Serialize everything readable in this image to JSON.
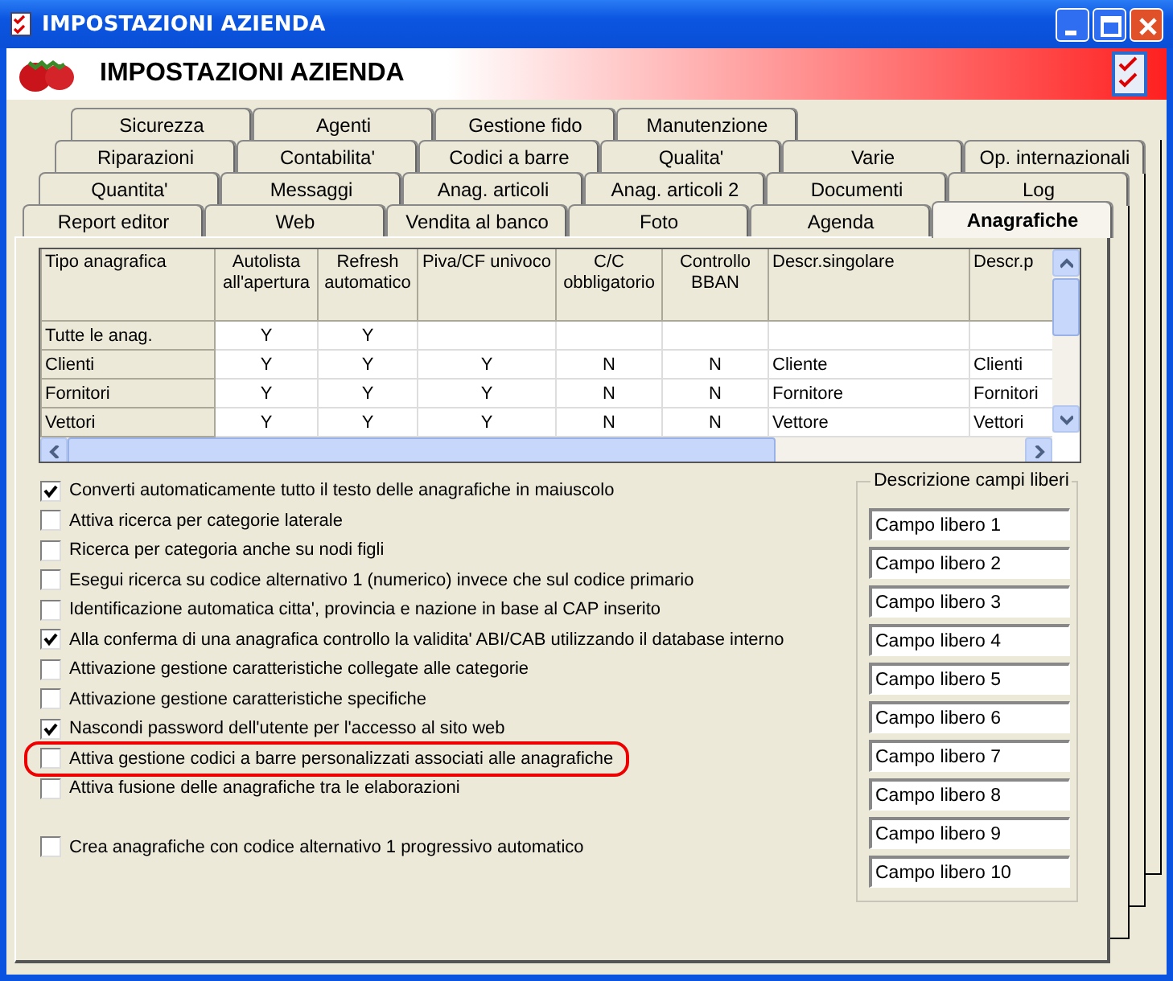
{
  "window": {
    "title": "IMPOSTAZIONI AZIENDA"
  },
  "header": {
    "title": "IMPOSTAZIONI AZIENDA"
  },
  "tab_rows": [
    [
      {
        "label": "Sicurezza",
        "selected": false
      },
      {
        "label": "Agenti",
        "selected": false
      },
      {
        "label": "Gestione fido",
        "selected": false
      },
      {
        "label": "Manutenzione",
        "selected": false
      }
    ],
    [
      {
        "label": "Riparazioni",
        "selected": false
      },
      {
        "label": "Contabilita'",
        "selected": false
      },
      {
        "label": "Codici a barre",
        "selected": false
      },
      {
        "label": "Qualita'",
        "selected": false
      },
      {
        "label": "Varie",
        "selected": false
      },
      {
        "label": "Op. internazionali",
        "selected": false
      }
    ],
    [
      {
        "label": "Quantita'",
        "selected": false
      },
      {
        "label": "Messaggi",
        "selected": false
      },
      {
        "label": "Anag. articoli",
        "selected": false
      },
      {
        "label": "Anag. articoli 2",
        "selected": false
      },
      {
        "label": "Documenti",
        "selected": false
      },
      {
        "label": "Log",
        "selected": false
      }
    ],
    [
      {
        "label": "Report editor",
        "selected": false
      },
      {
        "label": "Web",
        "selected": false
      },
      {
        "label": "Vendita al banco",
        "selected": false
      },
      {
        "label": "Foto",
        "selected": false
      },
      {
        "label": "Agenda",
        "selected": false
      },
      {
        "label": "Anagrafiche",
        "selected": true
      }
    ]
  ],
  "table": {
    "columns": [
      "Tipo anagrafica",
      "Autolista all'apertura",
      "Refresh automatico",
      "Piva/CF univoco",
      "C/C obbligatorio",
      "Controllo BBAN",
      "Descr.singolare",
      "Descr.p"
    ],
    "rows": [
      [
        "Tutte le anag.",
        "Y",
        "Y",
        "",
        "",
        "",
        "",
        ""
      ],
      [
        "Clienti",
        "Y",
        "Y",
        "Y",
        "N",
        "N",
        "Cliente",
        "Clienti"
      ],
      [
        "Fornitori",
        "Y",
        "Y",
        "Y",
        "N",
        "N",
        "Fornitore",
        "Fornitori"
      ],
      [
        "Vettori",
        "Y",
        "Y",
        "Y",
        "N",
        "N",
        "Vettore",
        "Vettori"
      ]
    ]
  },
  "option_groups": [
    [
      {
        "label": "Converti automaticamente tutto il testo delle anagrafiche in maiuscolo",
        "checked": true,
        "highlighted": false
      },
      {
        "label": "Attiva ricerca per categorie laterale",
        "checked": false,
        "highlighted": false
      },
      {
        "label": "Ricerca per categoria anche su nodi figli",
        "checked": false,
        "highlighted": false
      },
      {
        "label": "Esegui ricerca su codice alternativo 1 (numerico) invece che sul codice primario",
        "checked": false,
        "highlighted": false
      },
      {
        "label": "Identificazione automatica citta', provincia e nazione in base al CAP inserito",
        "checked": false,
        "highlighted": false
      },
      {
        "label": "Alla conferma di una anagrafica controllo la validita' ABI/CAB utilizzando il database interno",
        "checked": true,
        "highlighted": false
      },
      {
        "label": "Attivazione gestione caratteristiche collegate alle categorie",
        "checked": false,
        "highlighted": false
      },
      {
        "label": "Attivazione gestione caratteristiche specifiche",
        "checked": false,
        "highlighted": false
      },
      {
        "label": "Nascondi password dell'utente per l'accesso al sito web",
        "checked": true,
        "highlighted": false
      },
      {
        "label": "Attiva gestione codici a barre personalizzati associati alle anagrafiche",
        "checked": false,
        "highlighted": true
      },
      {
        "label": "Attiva fusione delle anagrafiche tra le elaborazioni",
        "checked": false,
        "highlighted": false
      }
    ],
    [
      {
        "label": "Crea anagrafiche con codice alternativo 1 progressivo automatico",
        "checked": false,
        "highlighted": false
      }
    ]
  ],
  "free_fields": {
    "legend": "Descrizione campi liberi",
    "values": [
      "Campo libero 1",
      "Campo libero 2",
      "Campo libero 3",
      "Campo libero 4",
      "Campo libero 5",
      "Campo libero 6",
      "Campo libero 7",
      "Campo libero 8",
      "Campo libero 9",
      "Campo libero 10"
    ]
  }
}
